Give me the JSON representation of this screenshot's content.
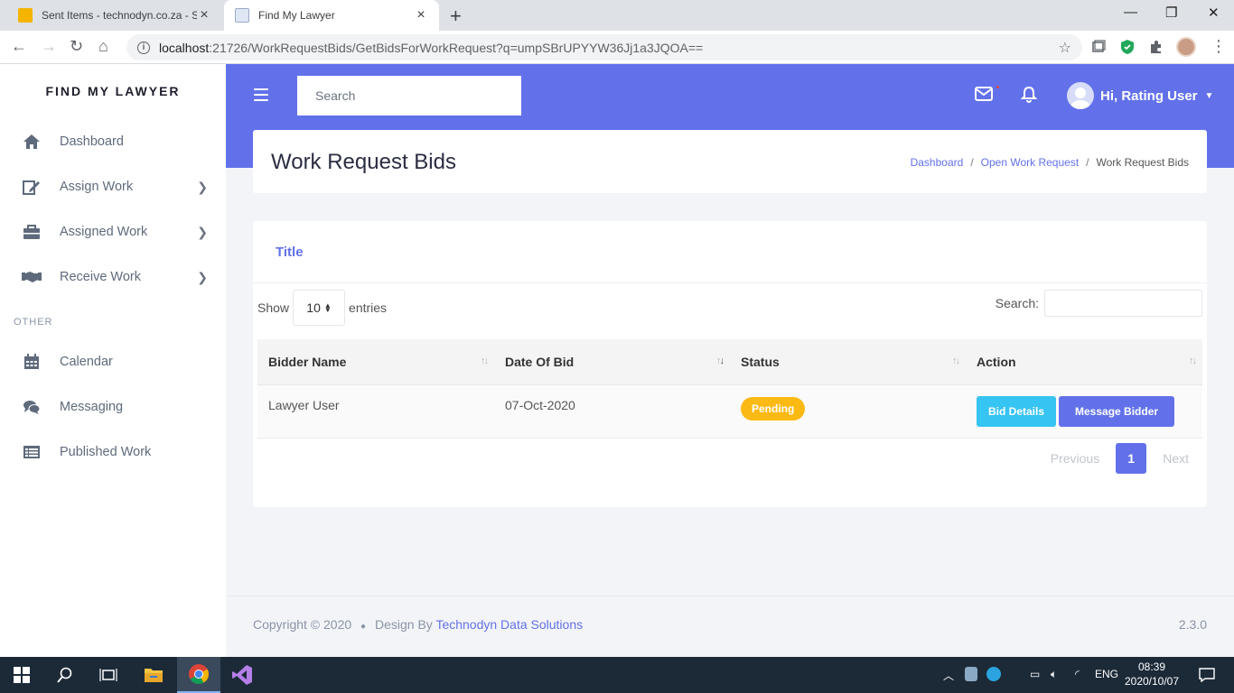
{
  "browser": {
    "tabs": [
      {
        "title": "Sent Items - technodyn.co.za - Sr"
      },
      {
        "title": "Find My Lawyer"
      }
    ],
    "url_host": "localhost",
    "url_rest": ":21726/WorkRequestBids/GetBidsForWorkRequest?q=umpSBrUPYYW36Jj1a3JQOA=="
  },
  "sidebar": {
    "brand": "FIND MY LAWYER",
    "items": [
      {
        "label": "Dashboard",
        "icon": "home-icon"
      },
      {
        "label": "Assign Work",
        "icon": "edit-icon",
        "has_children": true
      },
      {
        "label": "Assigned Work",
        "icon": "briefcase-icon",
        "has_children": true
      },
      {
        "label": "Receive Work",
        "icon": "handshake-icon",
        "has_children": true
      }
    ],
    "section_label": "OTHER",
    "other_items": [
      {
        "label": "Calendar",
        "icon": "calendar-icon"
      },
      {
        "label": "Messaging",
        "icon": "comments-icon"
      },
      {
        "label": "Published Work",
        "icon": "list-icon"
      }
    ]
  },
  "header": {
    "search_placeholder": "Search",
    "user_greeting": "Hi, Rating User",
    "accent_color": "#6271ea"
  },
  "page": {
    "title": "Work Request Bids",
    "breadcrumb": [
      "Dashboard",
      "Open Work Request",
      "Work Request Bids"
    ]
  },
  "card": {
    "title": "Title",
    "show_label": "Show",
    "entries_value": "10",
    "entries_label": "entries",
    "search_label": "Search:"
  },
  "table": {
    "columns": [
      "Bidder Name",
      "Date Of Bid",
      "Status",
      "Action"
    ],
    "rows": [
      {
        "bidder": "Lawyer User",
        "date": "07-Oct-2020",
        "status": "Pending",
        "actions": [
          "Bid Details",
          "Message Bidder"
        ]
      }
    ]
  },
  "pagination": {
    "previous": "Previous",
    "current": "1",
    "next": "Next"
  },
  "footer": {
    "copyright": "Copyright © 2020",
    "design_by": "Design By",
    "company": "Technodyn Data Solutions",
    "version": "2.3.0"
  },
  "taskbar": {
    "lang": "ENG",
    "time": "08:39",
    "date": "2020/10/07"
  }
}
